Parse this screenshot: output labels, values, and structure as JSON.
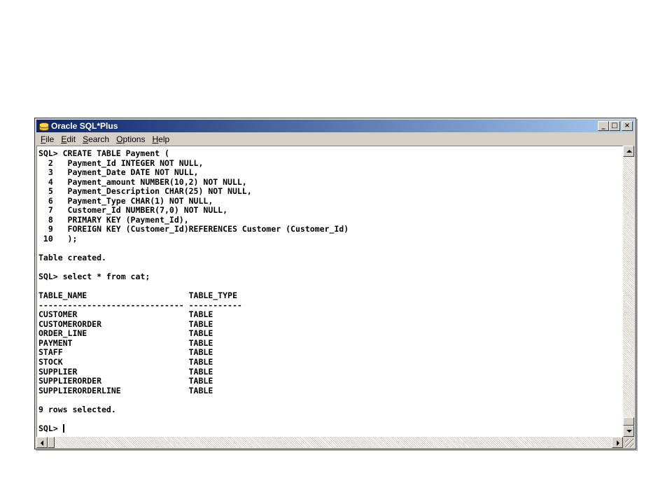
{
  "window": {
    "title": "Oracle SQL*Plus",
    "buttons": {
      "minimize": "_",
      "maximize": "□",
      "close": "×"
    }
  },
  "menu": [
    {
      "mnemonic": "F",
      "rest": "ile"
    },
    {
      "mnemonic": "E",
      "rest": "dit"
    },
    {
      "mnemonic": "S",
      "rest": "earch"
    },
    {
      "mnemonic": "O",
      "rest": "ptions"
    },
    {
      "mnemonic": "H",
      "rest": "elp"
    }
  ],
  "console": {
    "lines": [
      "SQL> CREATE TABLE Payment (",
      "  2   Payment_Id INTEGER NOT NULL,",
      "  3   Payment_Date DATE NOT NULL,",
      "  4   Payment_amount NUMBER(10,2) NOT NULL,",
      "  5   Payment_Description CHAR(25) NOT NULL,",
      "  6   Payment_Type CHAR(1) NOT NULL,",
      "  7   Customer_Id NUMBER(7,0) NOT NULL,",
      "  8   PRIMARY KEY (Payment_Id),",
      "  9   FOREIGN KEY (Customer_Id)REFERENCES Customer (Customer_Id)",
      " 10   );",
      "",
      "Table created.",
      "",
      "SQL> select * from cat;",
      "",
      "TABLE_NAME                     TABLE_TYPE",
      "------------------------------ -----------",
      "CUSTOMER                       TABLE",
      "CUSTOMERORDER                  TABLE",
      "ORDER_LINE                     TABLE",
      "PAYMENT                        TABLE",
      "STAFF                          TABLE",
      "STOCK                          TABLE",
      "SUPPLIER                       TABLE",
      "SUPPLIERORDER                  TABLE",
      "SUPPLIERORDERLINE              TABLE",
      "",
      "9 rows selected.",
      ""
    ],
    "prompt": "SQL> "
  },
  "colors": {
    "titlebar_start": "#0a246a",
    "titlebar_end": "#a6caf0",
    "chrome": "#d4d0c8",
    "console_bg": "#ffffff",
    "console_text": "#000000"
  }
}
